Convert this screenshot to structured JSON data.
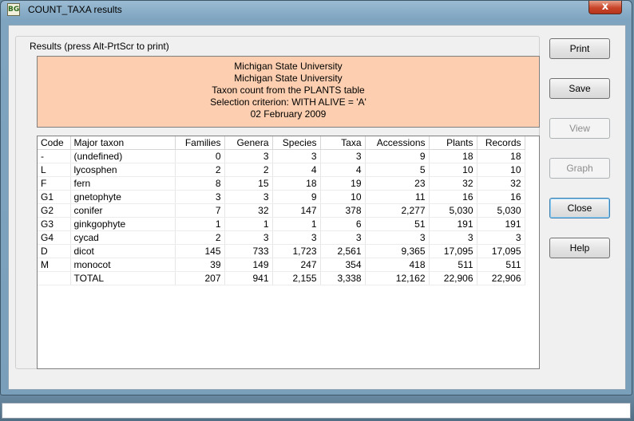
{
  "window": {
    "title": "COUNT_TAXA results",
    "close_glyph": "x"
  },
  "group": {
    "legend": "Results  (press Alt-PrtScr to print)"
  },
  "header": {
    "lines": [
      "Michigan State University",
      "Michigan State University",
      "Taxon count from the PLANTS table",
      "Selection criterion: WITH ALIVE = 'A'",
      "02 February 2009"
    ]
  },
  "table": {
    "columns": [
      "Code",
      "Major taxon",
      "Families",
      "Genera",
      "Species",
      "Taxa",
      "Accessions",
      "Plants",
      "Records"
    ],
    "rows": [
      [
        "-",
        "(undefined)",
        "0",
        "3",
        "3",
        "3",
        "9",
        "18",
        "18"
      ],
      [
        "L",
        "lycosphen",
        "2",
        "2",
        "4",
        "4",
        "5",
        "10",
        "10"
      ],
      [
        "F",
        "fern",
        "8",
        "15",
        "18",
        "19",
        "23",
        "32",
        "32"
      ],
      [
        "G1",
        "gnetophyte",
        "3",
        "3",
        "9",
        "10",
        "11",
        "16",
        "16"
      ],
      [
        "G2",
        "conifer",
        "7",
        "32",
        "147",
        "378",
        "2,277",
        "5,030",
        "5,030"
      ],
      [
        "G3",
        "ginkgophyte",
        "1",
        "1",
        "1",
        "6",
        "51",
        "191",
        "191"
      ],
      [
        "G4",
        "cycad",
        "2",
        "3",
        "3",
        "3",
        "3",
        "3",
        "3"
      ],
      [
        "D",
        "dicot",
        "145",
        "733",
        "1,723",
        "2,561",
        "9,365",
        "17,095",
        "17,095"
      ],
      [
        "M",
        "monocot",
        "39",
        "149",
        "247",
        "354",
        "418",
        "511",
        "511"
      ],
      [
        "",
        "TOTAL",
        "207",
        "941",
        "2,155",
        "3,338",
        "12,162",
        "22,906",
        "22,906"
      ]
    ]
  },
  "buttons": {
    "print": "Print",
    "save": "Save",
    "view": "View",
    "graph": "Graph",
    "close": "Close",
    "help": "Help"
  }
}
